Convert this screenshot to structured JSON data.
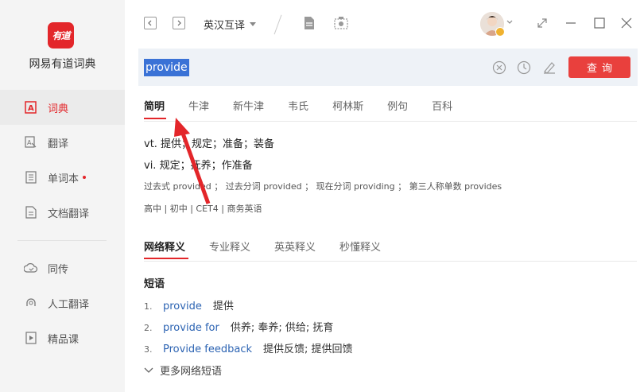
{
  "app": {
    "logo_text": "有道",
    "name": "网易有道词典"
  },
  "sidebar": {
    "items": [
      {
        "label": "词典",
        "active": true
      },
      {
        "label": "翻译"
      },
      {
        "label": "单词本"
      },
      {
        "label": "文档翻译"
      },
      {
        "label": "同传"
      },
      {
        "label": "人工翻译"
      },
      {
        "label": "精品课"
      }
    ]
  },
  "topbar": {
    "mode": "英汉互译"
  },
  "search": {
    "value": "provide",
    "button": "查询"
  },
  "dict_tabs": [
    "简明",
    "牛津",
    "新牛津",
    "韦氏",
    "柯林斯",
    "例句",
    "百科"
  ],
  "definitions": [
    "vt. 提供；规定；准备；装备",
    "vi. 规定；抚养；作准备"
  ],
  "forms": "过去式 provided ； 过去分词 provided ； 现在分词 providing ； 第三人称单数 provides",
  "tags": "高中 | 初中 | CET4 | 商务英语",
  "section_tabs": [
    "网络释义",
    "专业释义",
    "英英释义",
    "秒懂释义"
  ],
  "phrases": {
    "title": "短语",
    "items": [
      {
        "num": "1.",
        "en": "provide",
        "zh": "提供"
      },
      {
        "num": "2.",
        "en": "provide for",
        "zh": "供养;  奉养;  供给;  抚育"
      },
      {
        "num": "3.",
        "en": "Provide feedback",
        "zh": "提供反馈;  提供回馈"
      }
    ],
    "more": "更多网络短语"
  },
  "colors": {
    "brand_red": "#e3262a",
    "link_blue": "#2d64b3",
    "selection": "#3a72d6"
  }
}
